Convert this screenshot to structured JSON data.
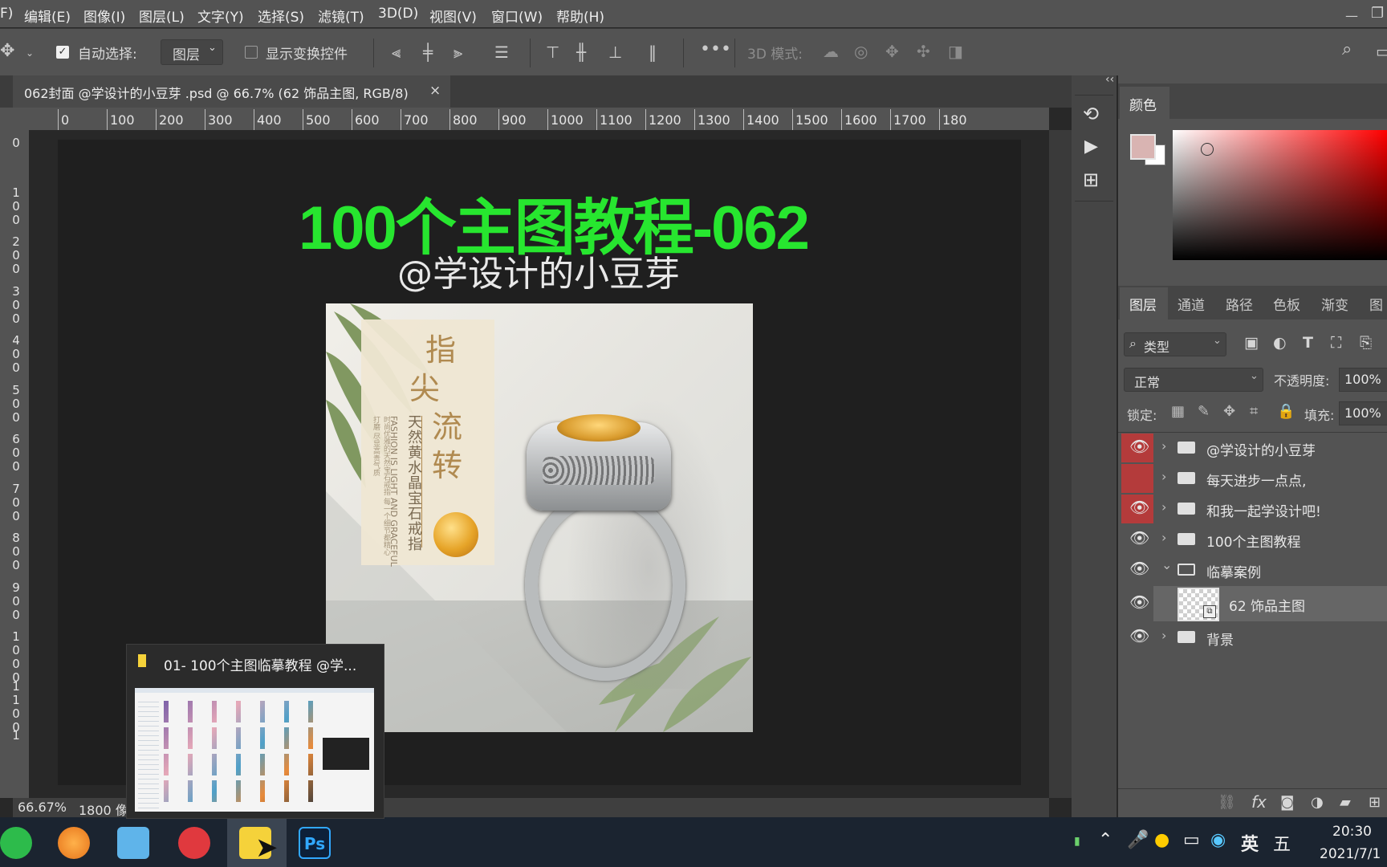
{
  "menu": [
    "F)",
    "编辑(E)",
    "图像(I)",
    "图层(L)",
    "文字(Y)",
    "选择(S)",
    "滤镜(T)",
    "3D(D)",
    "视图(V)",
    "窗口(W)",
    "帮助(H)"
  ],
  "options": {
    "auto_select_label": "自动选择:",
    "auto_select_value": "图层",
    "show_transform_label": "显示变换控件",
    "mode_3d_label": "3D 模式:"
  },
  "document": {
    "tab_title": "062封面 @学设计的小豆芽 .psd @ 66.7% (62 饰品主图, RGB/8)",
    "close": "×"
  },
  "ruler_h": [
    "0",
    "100",
    "200",
    "300",
    "400",
    "500",
    "600",
    "700",
    "800",
    "900",
    "1000",
    "1100",
    "1200",
    "1300",
    "1400",
    "1500",
    "1600",
    "1700",
    "180"
  ],
  "ruler_v": [
    [
      "0"
    ],
    [
      "1",
      "0",
      "0"
    ],
    [
      "2",
      "0",
      "0"
    ],
    [
      "3",
      "0",
      "0"
    ],
    [
      "4",
      "0",
      "0"
    ],
    [
      "5",
      "0",
      "0"
    ],
    [
      "6",
      "0",
      "0"
    ],
    [
      "7",
      "0",
      "0"
    ],
    [
      "8",
      "0",
      "0"
    ],
    [
      "9",
      "0",
      "0"
    ],
    [
      "1",
      "0",
      "0",
      "0"
    ],
    [
      "1",
      "1",
      "0",
      "0"
    ],
    [
      "1"
    ]
  ],
  "canvas": {
    "headline": "100个主图教程-062",
    "subheadline": "@学设计的小豆芽",
    "product": {
      "title_chars": [
        "指",
        "尖",
        "流",
        "转"
      ],
      "vertical_cn": "天然黄水晶宝石戒指",
      "vertical_en": "FASHION IS LIGHT AND GRACEFUL",
      "vertical_small": "时尚优雅的天然宝石戒指 每一个细节都精心打磨 尽显高贵气质"
    }
  },
  "status": {
    "zoom": "66.67%",
    "size": "1800 像"
  },
  "color_panel": {
    "tab": "颜色",
    "foreground": "#d9b4b2",
    "background": "#ffffff"
  },
  "layers_panel": {
    "tabs": [
      "图层",
      "通道",
      "路径",
      "色板",
      "渐变",
      "图"
    ],
    "filter_label": "类型",
    "blend_mode": "正常",
    "opacity_label": "不透明度:",
    "opacity_value": "100%",
    "lock_label": "锁定:",
    "fill_label": "填充:",
    "fill_value": "100%",
    "layers": [
      {
        "name": "@学设计的小豆芽",
        "type": "group",
        "visible": true,
        "eye_highlight": true
      },
      {
        "name": "每天进步一点点,",
        "type": "group",
        "visible": false,
        "eye_highlight": true
      },
      {
        "name": "和我一起学设计吧!",
        "type": "group",
        "visible": true,
        "eye_highlight": true
      },
      {
        "name": "100个主图教程",
        "type": "group",
        "visible": true,
        "eye_highlight": false
      },
      {
        "name": "临摹案例",
        "type": "group-open",
        "visible": true,
        "eye_highlight": false
      },
      {
        "name": "62 饰品主图",
        "type": "smart",
        "visible": true,
        "eye_highlight": false
      },
      {
        "name": "背景",
        "type": "group",
        "visible": true,
        "eye_highlight": false
      }
    ]
  },
  "popup": {
    "title": "01- 100个主图临摹教程 @学..."
  },
  "taskbar": {
    "tray_lang": "英",
    "tray_ime": "五",
    "time": "20:30",
    "date": "2021/7/1"
  }
}
